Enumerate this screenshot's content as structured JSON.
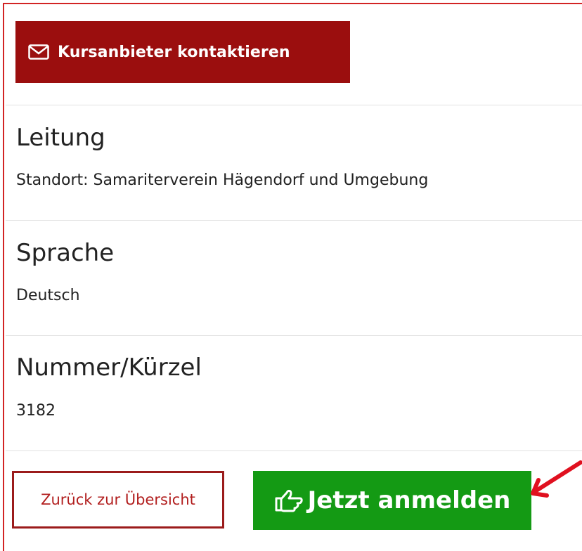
{
  "contact": {
    "icon": "envelope-icon",
    "label": "Kursanbieter kontaktieren",
    "color": "#9b0e0e"
  },
  "sections": [
    {
      "title": "Leitung",
      "value": "Standort: Samariterverein Hägendorf und Umgebung"
    },
    {
      "title": "Sprache",
      "value": "Deutsch"
    },
    {
      "title": "Nummer/Kürzel",
      "value": "3182"
    }
  ],
  "actions": {
    "back_label": "Zurück zur Übersicht",
    "register_label": "Jetzt anmelden",
    "register_icon": "thumbs-up-pointing-icon",
    "register_color": "#149a14",
    "back_color": "#9b1b1b"
  },
  "annotation": {
    "icon": "red-arrow-icon",
    "color": "#e0101f"
  }
}
